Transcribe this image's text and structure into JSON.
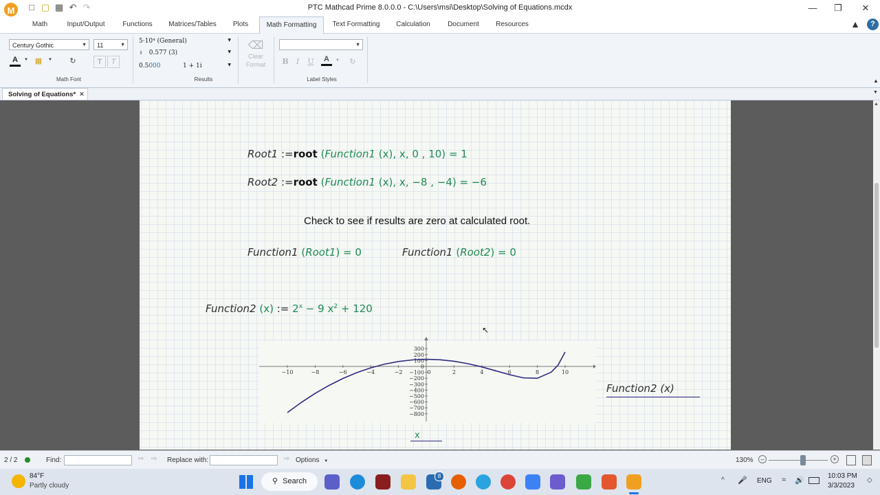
{
  "window": {
    "title": "PTC Mathcad Prime 8.0.0.0 - C:\\Users\\msi\\Desktop\\Solving of Equations.mcdx",
    "help_label": "?"
  },
  "ribbon_tabs": [
    "Math",
    "Input/Output",
    "Functions",
    "Matrices/Tables",
    "Plots",
    "Math Formatting",
    "Text Formatting",
    "Calculation",
    "Document",
    "Resources"
  ],
  "active_tab": "Math Formatting",
  "ribbon": {
    "math_font": {
      "font_value": "Century Gothic",
      "size_value": "11",
      "group_label": "Math Font",
      "color_letter": "A",
      "bold_letter": "T",
      "italic_letter": "T"
    },
    "results": {
      "format_value": "5·10⁴ (General)",
      "precision_value": "0.577 (3)",
      "trailing_value_main": "0.5",
      "trailing_value_zeros": "000",
      "complex_value": "1 + 1i",
      "group_label": "Results"
    },
    "clear_format": {
      "line1": "Clear",
      "line2": "Format"
    },
    "label_styles": {
      "style_value": "",
      "group_label": "Label Styles",
      "bold": "B",
      "italic": "I",
      "underline": "U",
      "color_letter": "A"
    }
  },
  "document_tab": {
    "label": "Solving of Equations*"
  },
  "worksheet": {
    "root1": {
      "name": "Root1",
      "define": ":=",
      "func": "root",
      "arg_fn": "Function1",
      "var": "x",
      "args": ", 0 , 10",
      "result": "= 1"
    },
    "root2": {
      "name": "Root2",
      "define": ":=",
      "func": "root",
      "arg_fn": "Function1",
      "var": "x",
      "args": ", −8 , −4",
      "result": "= −6"
    },
    "check_text": "Check to see if results are zero at calculated root.",
    "eval1": {
      "fn": "Function1",
      "arg": "Root1",
      "result": "= 0"
    },
    "eval2": {
      "fn": "Function1",
      "arg": "Root2",
      "result": "= 0"
    },
    "function2": {
      "name": "Function2",
      "var": "x",
      "define": ":=",
      "base": "2",
      "exp1": "x",
      "minus": "− 9",
      "x": "x",
      "exp2": "2",
      "tail": "+ 120"
    },
    "plot": {
      "y_label": "Function2 (x)",
      "x_label": "x"
    }
  },
  "chart_data": {
    "type": "line",
    "xlabel": "x",
    "ylabel": "Function2 (x)",
    "x_ticks": [
      "−10",
      "−8",
      "−6",
      "−4",
      "−2",
      "0",
      "2",
      "4",
      "6",
      "8",
      "10"
    ],
    "y_ticks": [
      "300",
      "200",
      "100",
      "0",
      "−100",
      "−200",
      "−300",
      "−400",
      "−500",
      "−600",
      "−700",
      "−800"
    ],
    "xlim": [
      -10,
      10
    ],
    "ylim": [
      -800,
      300
    ],
    "series": [
      {
        "x": [
          -10,
          -9,
          -8,
          -7,
          -6,
          -5,
          -4,
          -3,
          -2,
          -1,
          0,
          1,
          2,
          3,
          4,
          5,
          6,
          7,
          8,
          9,
          9.5,
          10
        ],
        "y": [
          -780,
          -609,
          -456,
          -321,
          -204,
          -105,
          -24,
          39,
          84,
          111,
          121,
          113,
          88,
          47,
          -8,
          -73,
          -140,
          -193,
          -200,
          -97,
          26,
          244
        ]
      }
    ]
  },
  "status_bar": {
    "page": "2 / 2",
    "find_label": "Find:",
    "replace_label": "Replace with:",
    "options_label": "Options",
    "zoom": "130%"
  },
  "taskbar": {
    "weather_temp": "84°F",
    "weather_desc": "Partly cloudy",
    "search_label": "Search",
    "mail_badge": "8",
    "lang": "ENG",
    "time": "10:03 PM",
    "date": "3/3/2023"
  },
  "colors": {
    "accent": "#2e6da4",
    "math_green": "#1f8a55",
    "plot_line": "#2b2a80",
    "logo_orange": "#f0a020"
  }
}
